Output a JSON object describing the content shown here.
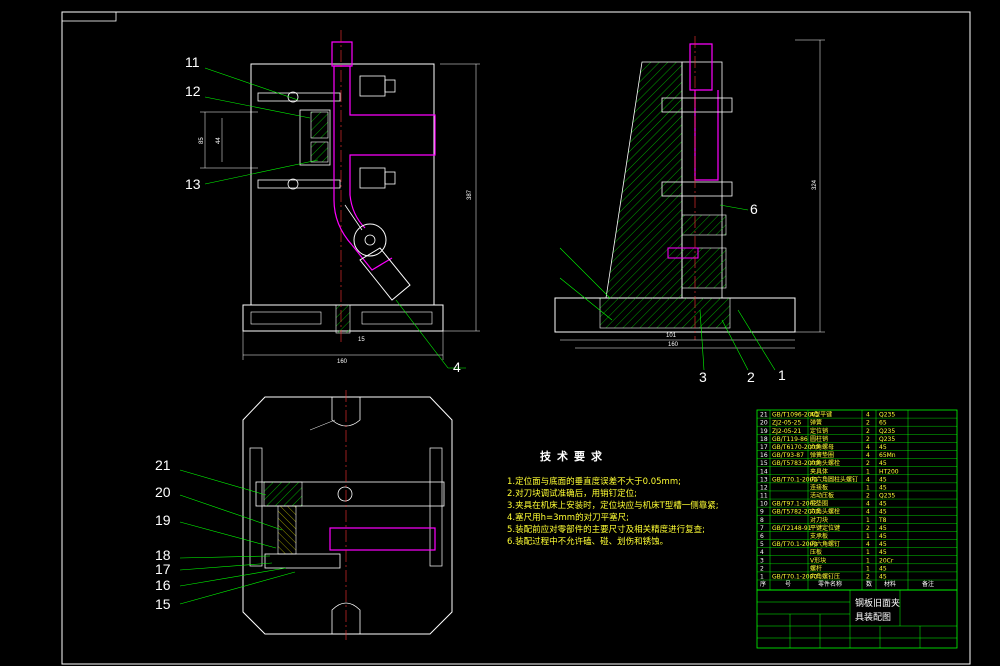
{
  "drawing": {
    "title_line1": "钢板旧面夹",
    "title_line2": "具装配图"
  },
  "callouts": {
    "front_view": [
      "11",
      "12",
      "13",
      "4"
    ],
    "side_view": [
      "3",
      "2",
      "1",
      "6"
    ],
    "top_view": [
      "21",
      "20",
      "19",
      "18",
      "17",
      "16",
      "15"
    ]
  },
  "dimensions": {
    "width_160": "160",
    "base_15": "15",
    "height_387": "387",
    "height_324": "324",
    "side_101": "101",
    "side_160": "160",
    "pitch_85": "85",
    "pitch_44": "44"
  },
  "requirements": {
    "title": "技术要求",
    "items": [
      "1.定位面与底面的垂直度误差不大于0.05mm;",
      "2.对刀块调试准确后，用销钉定位;",
      "3.夹具在机床上安装时，定位块应与机床T型槽一侧靠紧;",
      "4.塞尺用h=3mm的对刀平塞尺;",
      "5.装配前应对零部件的主要尺寸及相关精度进行复查;",
      "6.装配过程中不允许磕、碰、划伤和锈蚀。"
    ]
  },
  "bom": {
    "rows": [
      {
        "no": "21",
        "code": "GB/T1096-2003",
        "name": "A型平键",
        "qty": "4",
        "mat": "Q235"
      },
      {
        "no": "20",
        "code": "ZJ2-05-25",
        "name": "弹簧",
        "qty": "2",
        "mat": "65"
      },
      {
        "no": "19",
        "code": "ZJ2-05-21",
        "name": "定位销",
        "qty": "2",
        "mat": "Q235"
      },
      {
        "no": "18",
        "code": "GB/T119-86",
        "name": "圆柱销",
        "qty": "2",
        "mat": "Q235"
      },
      {
        "no": "17",
        "code": "GB/T6170-2000",
        "name": "六角螺母",
        "qty": "4",
        "mat": "45"
      },
      {
        "no": "16",
        "code": "GB/T93-87",
        "name": "弹簧垫圈",
        "qty": "4",
        "mat": "65Mn"
      },
      {
        "no": "15",
        "code": "GB/T5783-2000",
        "name": "六角头螺栓",
        "qty": "2",
        "mat": "45"
      },
      {
        "no": "14",
        "code": "",
        "name": "夹具体",
        "qty": "1",
        "mat": "HT200"
      },
      {
        "no": "13",
        "code": "GB/T70.1-2000",
        "name": "内六角圆柱头螺钉",
        "qty": "4",
        "mat": "45"
      },
      {
        "no": "12",
        "code": "",
        "name": "连接板",
        "qty": "1",
        "mat": "45"
      },
      {
        "no": "11",
        "code": "",
        "name": "活动压板",
        "qty": "2",
        "mat": "Q235"
      },
      {
        "no": "10",
        "code": "GB/T97.1-2002",
        "name": "平垫圈",
        "qty": "4",
        "mat": "45"
      },
      {
        "no": "9",
        "code": "GB/T5782-2000",
        "name": "六角头螺栓",
        "qty": "4",
        "mat": "45"
      },
      {
        "no": "8",
        "code": "",
        "name": "对刀块",
        "qty": "1",
        "mat": "T8"
      },
      {
        "no": "7",
        "code": "GB/T2148-91",
        "name": "平键定位键",
        "qty": "2",
        "mat": "45"
      },
      {
        "no": "6",
        "code": "",
        "name": "支承板",
        "qty": "1",
        "mat": "45"
      },
      {
        "no": "5",
        "code": "GB/T70.1-2000",
        "name": "内六角螺钉",
        "qty": "4",
        "mat": "45"
      },
      {
        "no": "4",
        "code": "",
        "name": "压板",
        "qty": "1",
        "mat": "45"
      },
      {
        "no": "3",
        "code": "",
        "name": "V形块",
        "qty": "1",
        "mat": "20Cr"
      },
      {
        "no": "2",
        "code": "",
        "name": "螺杆",
        "qty": "1",
        "mat": "45"
      },
      {
        "no": "1",
        "code": "GB/T70.1-2000",
        "name": "六角螺钉压",
        "qty": "2",
        "mat": "45"
      }
    ],
    "header": {
      "no": "序",
      "code": "号",
      "name": "零件名称",
      "qty": "数",
      "mat": "材料",
      "note": "备注"
    }
  },
  "colors": {
    "background": "#000000",
    "frame": "#ffffff",
    "part_outline": "#ffffff",
    "hatch": "#00cc00",
    "mechanism": "#ff00ff",
    "center_line": "#ff3333",
    "dimension": "#ffffff",
    "leader": "#00ff00",
    "bom_grid": "#00ff00",
    "text_yellow": "#ffff33"
  }
}
